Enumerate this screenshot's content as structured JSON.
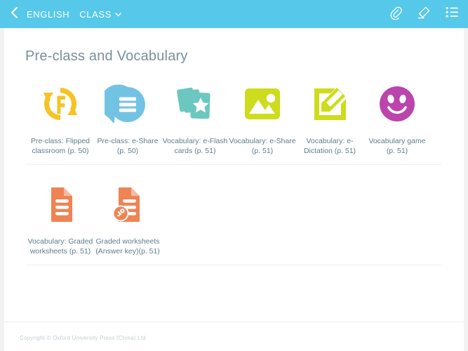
{
  "header": {
    "back_icon": "chevron-left-icon",
    "subject_label": "ENGLISH",
    "class_label": "CLASS",
    "class_caret_icon": "chevron-down-icon",
    "actions": [
      {
        "name": "attachment-icon",
        "label": "Attachment"
      },
      {
        "name": "eraser-icon",
        "label": "Eraser"
      },
      {
        "name": "list-menu-icon",
        "label": "List menu"
      }
    ],
    "background_color": "#56c8ea"
  },
  "main": {
    "title": "Pre-class and Vocabulary",
    "rows": [
      {
        "tiles": [
          {
            "icon": "flipped-classroom-icon",
            "label": "Pre-class: Flipped classroom (p. 50)",
            "color": "#f6c324"
          },
          {
            "icon": "speech-bubble-icon",
            "label": "Pre-class: e-Share (p. 50)",
            "color": "#72c3e3"
          },
          {
            "icon": "flash-cards-icon",
            "label": "Vocabulary: e-Flash cards (p. 51)",
            "color": "#6cc7c0"
          },
          {
            "icon": "image-icon",
            "label": "Vocabulary: e-Share (p. 51)",
            "color": "#cddc1c"
          },
          {
            "icon": "dictation-pencil-icon",
            "label": "Vocabulary: e-Dictation (p. 51)",
            "color": "#cddc1c"
          },
          {
            "icon": "smiley-face-icon",
            "label": "Vocabulary game (p. 51)",
            "color": "#bb44ad"
          }
        ]
      },
      {
        "tiles": [
          {
            "icon": "worksheet-document-icon",
            "label": "Vocabulary: Graded worksheets (p. 51)",
            "color": "#ef8354"
          },
          {
            "icon": "answer-key-document-icon",
            "label": "Graded worksheets (Answer key)(p. 51)",
            "color": "#ef8354"
          }
        ]
      }
    ]
  },
  "footer": {
    "copyright": "Copyright © Oxford University Press (China) Ltd"
  }
}
